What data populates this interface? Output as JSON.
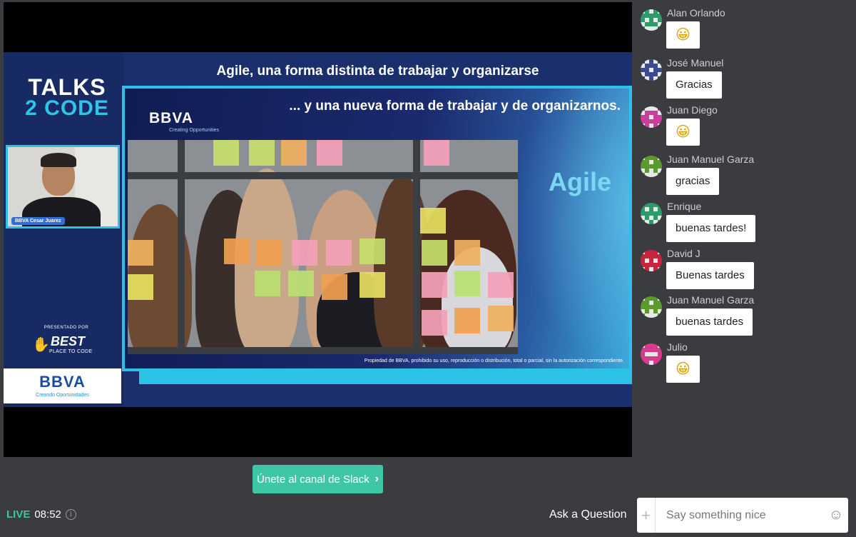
{
  "slide": {
    "logo_line1": "TALKS",
    "logo_line2": "2 CODE",
    "title": "Agile, una forma distinta de trabajar y organizarse",
    "inner_heading": "... y una nueva forma de trabajar y de organizarnos.",
    "inner_bbva": "BBVA",
    "inner_bbva_sub": "Creating Opportunities",
    "agile_word": "Agile",
    "footer": "Propiedad de BBVA, prohibido su uso, reproducción o distribución, total o parcial, sin la autorización correspondiente.",
    "speaker_name": "BBVA Cesar Juarez",
    "presentado_por": "PRESENTADO POR",
    "best_logo": "BEST",
    "best_sub": "PLACE TO CODE",
    "bbva_left": "BBVA",
    "bbva_left_sub": "Creando Oportunidades",
    "accent_color": "#2bc2e5"
  },
  "slack_button": {
    "label": "Únete al canal de Slack",
    "icon": "chevron-right-icon"
  },
  "status": {
    "live_label": "LIVE",
    "time": "08:52",
    "info_icon": "info-icon"
  },
  "ask": {
    "label": "Ask a Question"
  },
  "chat_input": {
    "placeholder": "Say something nice",
    "plus_icon": "plus-icon",
    "emoji_icon": "smile-icon"
  },
  "chat": {
    "messages": [
      {
        "author": "Alan Orlando",
        "text": "😀",
        "emoji": true,
        "avatar_color": "#2f9a6a"
      },
      {
        "author": "José Manuel",
        "text": "Gracias",
        "emoji": false,
        "avatar_color": "#3c4b8f"
      },
      {
        "author": "Juan Diego",
        "text": "😀",
        "emoji": true,
        "avatar_color": "#c8409c"
      },
      {
        "author": "Juan Manuel Garza",
        "text": "gracias",
        "emoji": false,
        "avatar_color": "#5a9a2e"
      },
      {
        "author": "Enrique",
        "text": "buenas tardes!",
        "emoji": false,
        "avatar_color": "#2f9a6a"
      },
      {
        "author": "David J",
        "text": "Buenas tardes",
        "emoji": false,
        "avatar_color": "#c8243c"
      },
      {
        "author": "Juan Manuel Garza",
        "text": "buenas tardes",
        "emoji": false,
        "avatar_color": "#5a9a2e"
      },
      {
        "author": "Julio",
        "text": "😀",
        "emoji": true,
        "avatar_color": "#d83a8c"
      }
    ]
  }
}
